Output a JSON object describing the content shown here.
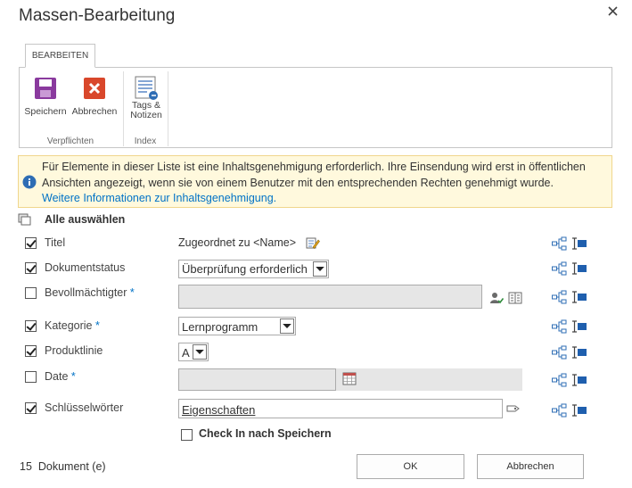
{
  "dialog": {
    "title": "Massen-Bearbeitung"
  },
  "ribbon": {
    "tab": "BEARBEITEN",
    "buttons": {
      "save": "Speichern",
      "cancel": "Abbrechen",
      "tags_line1": "Tags &",
      "tags_line2": "Notizen"
    },
    "groups": {
      "commit": "Verpflichten",
      "index": "Index"
    }
  },
  "info": {
    "line1": "Für Elemente in dieser Liste ist eine Inhaltsgenehmigung erforderlich. Ihre Einsendung wird erst in öffentlichen",
    "line2": "Ansichten angezeigt, wenn sie von einem Benutzer mit den entsprechenden Rechten genehmigt wurde.",
    "link": "Weitere Informationen zur Inhaltsgenehmigung."
  },
  "select_all": "Alle auswählen",
  "fields": [
    {
      "label": "Titel",
      "required": false,
      "checked": true,
      "value": "Zugeordnet zu <Name>"
    },
    {
      "label": "Dokumentstatus",
      "required": false,
      "checked": true,
      "value": "Überprüfung erforderlich"
    },
    {
      "label": "Bevollmächtigter",
      "required": true,
      "checked": false,
      "value": ""
    },
    {
      "label": "Kategorie",
      "required": true,
      "checked": true,
      "value": "Lernprogramm"
    },
    {
      "label": "Produktlinie",
      "required": false,
      "checked": true,
      "value": "A"
    },
    {
      "label": "Date",
      "required": true,
      "checked": false,
      "value": ""
    },
    {
      "label": "Schlüsselwörter",
      "required": false,
      "checked": true,
      "value": "Eigenschaften"
    }
  ],
  "required_marker": "*",
  "checkin": {
    "label": "Check In nach Speichern",
    "checked": false
  },
  "footer": {
    "count": "15  Dokument (e)",
    "ok": "OK",
    "cancel": "Abbrechen"
  },
  "colors": {
    "accent": "#0072c6",
    "info_bg": "#fff9dd",
    "save_icon": "#8a3a9e",
    "cancel_icon": "#d9472b"
  },
  "icons": {
    "close": "close-icon",
    "save": "floppy-disk-icon",
    "cancel": "red-x-icon",
    "tags": "tags-notes-icon",
    "info": "info-icon",
    "select_all": "select-all-icon",
    "edit": "edit-pencil-icon",
    "people": "people-picker-icon",
    "browse": "address-book-icon",
    "calendar": "calendar-icon",
    "keywords": "tag-icon",
    "hierarchy": "hierarchy-icon",
    "column": "column-icon"
  }
}
